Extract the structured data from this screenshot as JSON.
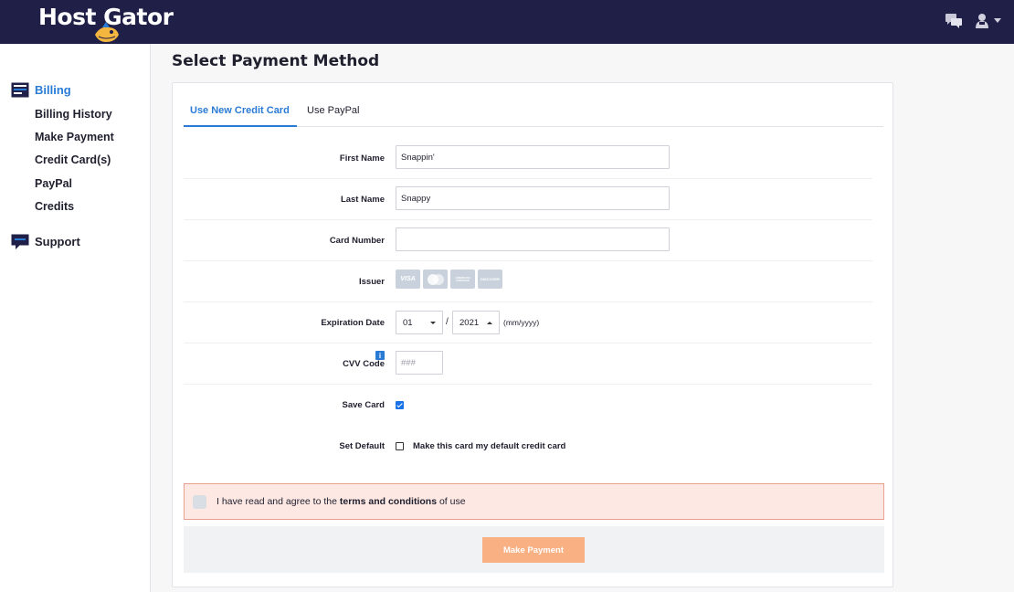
{
  "brand": {
    "name": "Host Gator",
    "accent": "#2a7bd5",
    "topbar_color": "#1f1f47"
  },
  "topbar": {
    "icons": [
      "chat-icon",
      "user-icon",
      "chevron-down-icon"
    ]
  },
  "sidebar": {
    "billing": {
      "label": "Billing",
      "icon": "billing-icon"
    },
    "billing_items": [
      "Billing History",
      "Make Payment",
      "Credit Card(s)",
      "PayPal",
      "Credits"
    ],
    "support": {
      "label": "Support",
      "icon": "support-icon"
    }
  },
  "main": {
    "title": "Select Payment Method",
    "tabs": [
      {
        "label": "Use New Credit Card",
        "active": true
      },
      {
        "label": "Use PayPal",
        "active": false
      }
    ],
    "form": {
      "first_name": {
        "label": "First Name",
        "value": "Snappin'"
      },
      "last_name": {
        "label": "Last Name",
        "value": "Snappy"
      },
      "card_number": {
        "label": "Card Number",
        "value": ""
      },
      "issuer": {
        "label": "Issuer",
        "logos": [
          "VISA",
          "mastercard",
          "AMERICAN EXPRESS",
          "DISCOVER"
        ]
      },
      "expiration": {
        "label": "Expiration Date",
        "month": "01",
        "separator": "/",
        "year": "2021",
        "hint": "(mm/yyyy)"
      },
      "cvv": {
        "label": "CVV Code",
        "placeholder": "###",
        "info": "i"
      },
      "save_card": {
        "label": "Save Card",
        "checked": true
      },
      "set_default": {
        "label": "Set Default",
        "text": "Make this card my default credit card",
        "checked": false
      }
    },
    "terms": {
      "prefix": "I have read and agree to the ",
      "link": "terms and conditions",
      "suffix": " of use"
    },
    "submit_label": "Make Payment"
  }
}
